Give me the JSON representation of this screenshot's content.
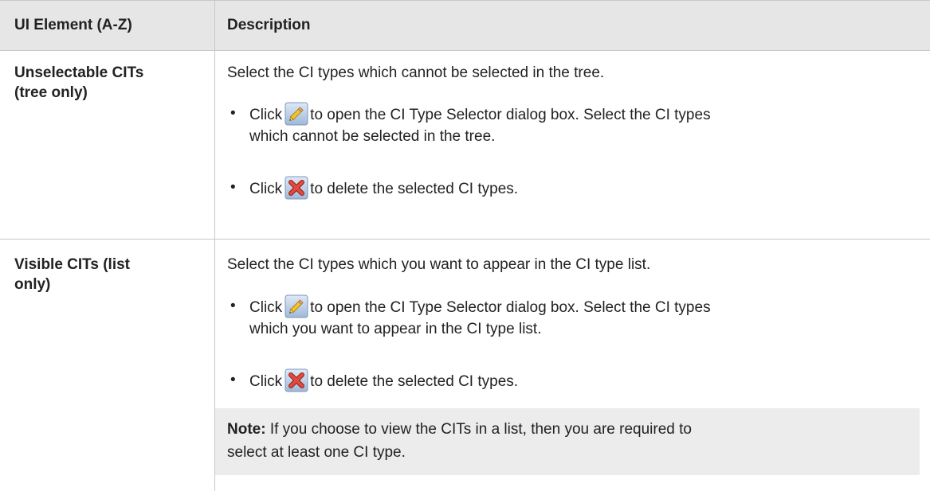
{
  "header": {
    "col1": "UI Element (A-Z)",
    "col2": "Description"
  },
  "rows": [
    {
      "name_line1": "Unselectable CITs",
      "name_line2": "(tree only)",
      "intro": "Select the CI types which cannot be selected in the tree.",
      "bullets": [
        {
          "pre": "Click",
          "icon": "pencil-edit-icon",
          "post_line1": "to open the CI Type Selector dialog box. Select the CI types",
          "post_line2": "which cannot be selected in the tree."
        },
        {
          "pre": "Click",
          "icon": "red-x-delete-icon",
          "post_line1": "to delete the selected CI types."
        }
      ]
    },
    {
      "name_line1": "Visible CITs (list",
      "name_line2": "only)",
      "intro": "Select the CI types which you want to appear in the CI type list.",
      "bullets": [
        {
          "pre": "Click",
          "icon": "pencil-edit-icon",
          "post_line1": "to open the CI Type Selector dialog box. Select the CI types",
          "post_line2": "which you want to appear in the CI type list."
        },
        {
          "pre": "Click",
          "icon": "red-x-delete-icon",
          "post_line1": "to delete the selected CI types."
        }
      ],
      "note": {
        "label": "Note:",
        "line1": "If you choose to view the CITs in a list, then you are required to",
        "line2": "select at least one CI type."
      }
    }
  ],
  "bullet_char": "•",
  "colors": {
    "header_bg": "#e6e6e6",
    "border": "#c8c8c8",
    "note_bg": "#ececec",
    "text": "#222222",
    "delete_red": "#d9302a",
    "pencil_yellow": "#f2c230"
  }
}
